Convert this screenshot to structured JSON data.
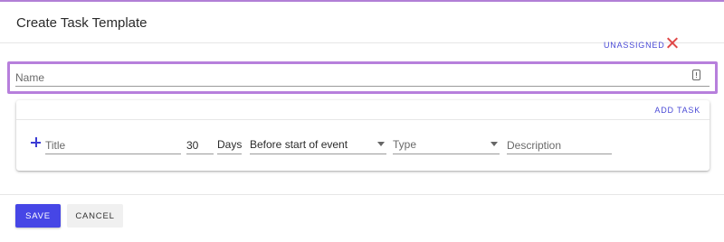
{
  "dialog": {
    "title": "Create Task Template"
  },
  "name_field": {
    "placeholder": "Name",
    "value": "",
    "icon": "info-box-icon"
  },
  "task_card": {
    "add_task_label": "ADD TASK",
    "row": {
      "add_icon": "plus-icon",
      "title_placeholder": "Title",
      "title_value": "",
      "count_value": "30",
      "unit_label": "Days",
      "when_selected": "Before start of event",
      "type_placeholder": "Type",
      "description_placeholder": "Description",
      "description_value": "",
      "assignee_label": "UNASSIGNED",
      "remove_icon": "close-icon"
    }
  },
  "actions": {
    "save_label": "SAVE",
    "cancel_label": "CANCEL"
  },
  "colors": {
    "accent": "#4646e6",
    "focus_outline": "#b77fdc",
    "link": "#4a4ad6",
    "danger": "#e04848"
  }
}
